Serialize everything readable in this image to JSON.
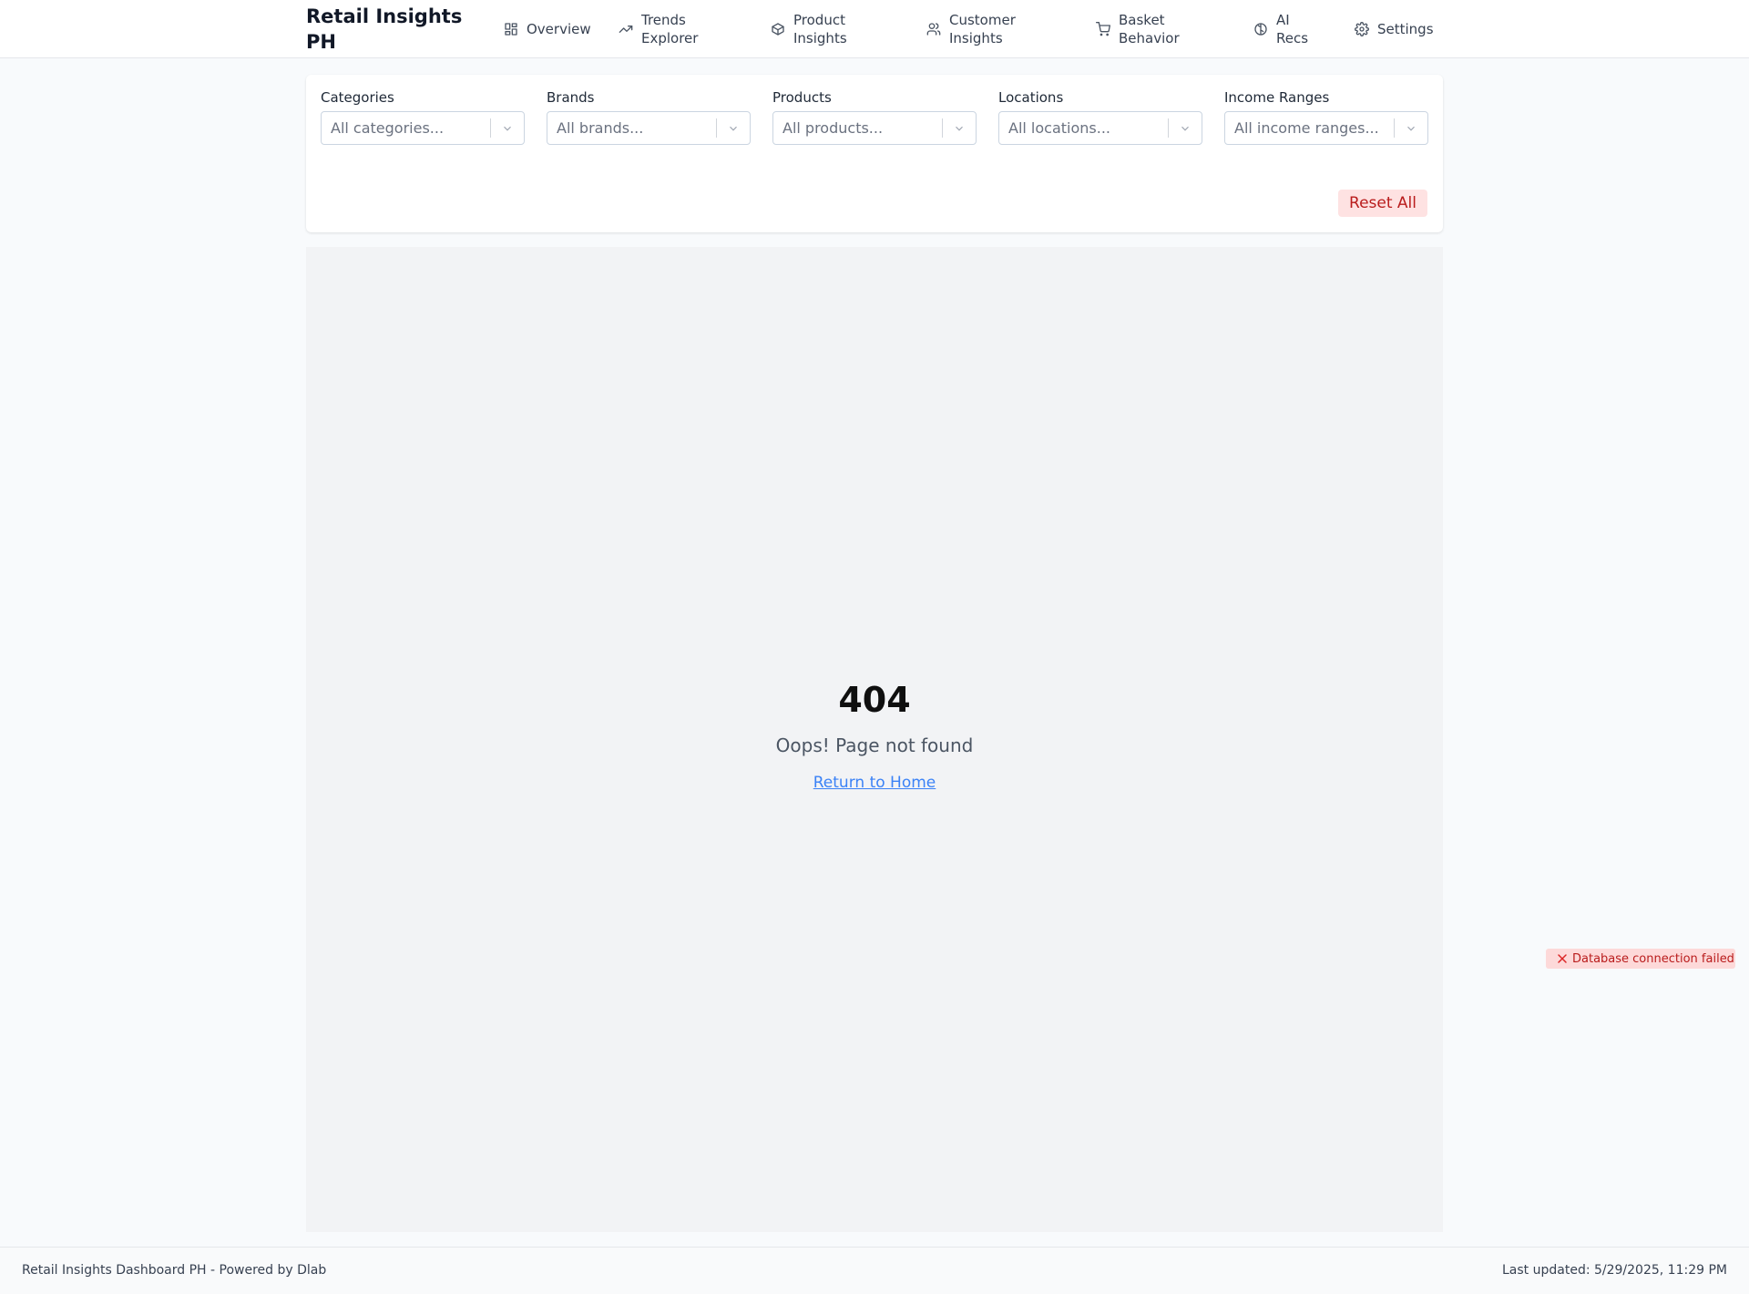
{
  "header": {
    "brand": "Retail Insights PH",
    "nav": [
      {
        "label": "Overview",
        "icon": "dashboard-icon"
      },
      {
        "label": "Trends Explorer",
        "icon": "trending-up-icon"
      },
      {
        "label": "Product Insights",
        "icon": "package-icon"
      },
      {
        "label": "Customer Insights",
        "icon": "users-icon"
      },
      {
        "label": "Basket Behavior",
        "icon": "shopping-cart-icon"
      },
      {
        "label": "AI Recs",
        "icon": "brain-icon"
      },
      {
        "label": "Settings",
        "icon": "gear-icon"
      }
    ]
  },
  "filters": {
    "categories": {
      "label": "Categories",
      "placeholder": "All categories..."
    },
    "brands": {
      "label": "Brands",
      "placeholder": "All brands..."
    },
    "products": {
      "label": "Products",
      "placeholder": "All products..."
    },
    "locations": {
      "label": "Locations",
      "placeholder": "All locations..."
    },
    "income": {
      "label": "Income Ranges",
      "placeholder": "All income ranges..."
    },
    "reset_label": "Reset All"
  },
  "not_found": {
    "code": "404",
    "message": "Oops! Page not found",
    "link_label": "Return to Home"
  },
  "toast": {
    "message": "Database connection failed",
    "icon": "close-x-icon",
    "color": "#b91c1c"
  },
  "footer": {
    "left": "Retail Insights Dashboard PH - Powered by Dlab",
    "right": "Last updated: 5/29/2025, 11:29 PM"
  },
  "colors": {
    "accent_link": "#3b82f6",
    "danger_bg": "#fee2e2",
    "danger_text": "#b91c1c"
  }
}
